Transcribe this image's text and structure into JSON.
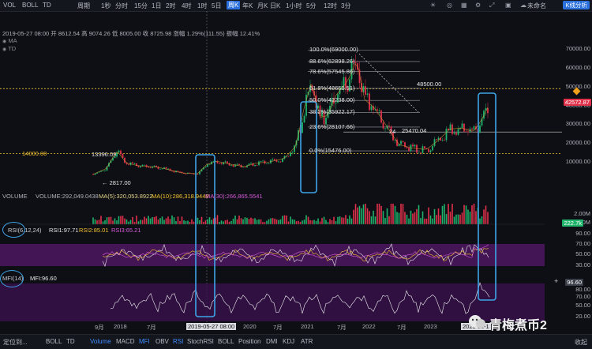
{
  "toolbar": {
    "items": [
      "VOL",
      "BOLL",
      "TD",
      "周期",
      "1秒",
      "分时",
      "15分",
      "1日",
      "2时",
      "4时",
      "1时",
      "5日",
      "A",
      "主力",
      "大额",
      "筹",
      "周K",
      "年K",
      "月K",
      "日K",
      "1小时",
      "5分",
      "12时",
      "3分"
    ],
    "active": "周K",
    "account": "未命名",
    "kline_button": "K线分析"
  },
  "info_bar": "2019-05-27 08:00   开 8612.54  高 9074.26  低 8005.00  收 8725.98  涨幅 1.29%(111.55)  振幅 12.41%",
  "indicators_top": [
    "MA",
    "TD"
  ],
  "price_axis": [
    "70000.00",
    "60000.00",
    "50000.00",
    "40000.00",
    "30000.00",
    "20000.00",
    "10000.00"
  ],
  "current_price": "42572.87",
  "level_48500": "48500.00",
  "level_14000": "14000.00",
  "fib": [
    "100.0%(69000.00)",
    "88.6%(62898.26)",
    "78.6%(57545.86)",
    "61.8%(48653.51)",
    "50.0%(42238.00)",
    "38.2%(35922.17)",
    "23.6%(28107.66)",
    "0.0%(15476.00)"
  ],
  "annotations": {
    "low_2817": "2817.00",
    "high_13396": "13396.09",
    "mid_25470": "25470.04",
    "lbl_24": "24"
  },
  "volume": {
    "title": "VOLUME",
    "vol": "VOLUME:292,049.0438",
    "ma5": "MA(5):320,053.8922",
    "ma10": "MA(10):286,318.9448",
    "ma30": "MA(30):266,865.5541",
    "axis_top": "2.00M",
    "axis_mid": "1.00M",
    "current": "222.7k"
  },
  "rsi": {
    "title": "RSI(6,12,24)",
    "rsi1": "RSI1:97.71",
    "rsi2": "RSI2:85.01",
    "rsi3": "RSI3:65.21",
    "axis": [
      "90.00",
      "70.00",
      "50.00",
      "30.00"
    ]
  },
  "mfi": {
    "title": "MFI(14)",
    "value": "MFI:96.60",
    "axis": [
      "80.00",
      "70.00",
      "50.00",
      "20.00"
    ],
    "current": "96.60"
  },
  "time_axis": [
    "9月",
    "2018",
    "7月",
    "2019-05-27 08:00",
    "2020",
    "7月",
    "2021",
    "7月",
    "2022",
    "7月",
    "2023",
    "2023-11-1"
  ],
  "bottom": {
    "left": "定位到...",
    "items": [
      "BOLL",
      "TD",
      "Volume",
      "MACD",
      "MFI",
      "OBV",
      "RSI",
      "StochRSI",
      "BOLL",
      "Position",
      "DMI",
      "KDJ",
      "ATR"
    ],
    "active": [
      "Volume",
      "MFI",
      "RSI"
    ],
    "right": "收起"
  },
  "watermark": "青梅煮币2",
  "colors": {
    "up": "#1fb36b",
    "down": "#e0304a",
    "highlight": "#3da5e8",
    "rsi_band": "#5a1a6a",
    "yellow": "#f2c230"
  }
}
